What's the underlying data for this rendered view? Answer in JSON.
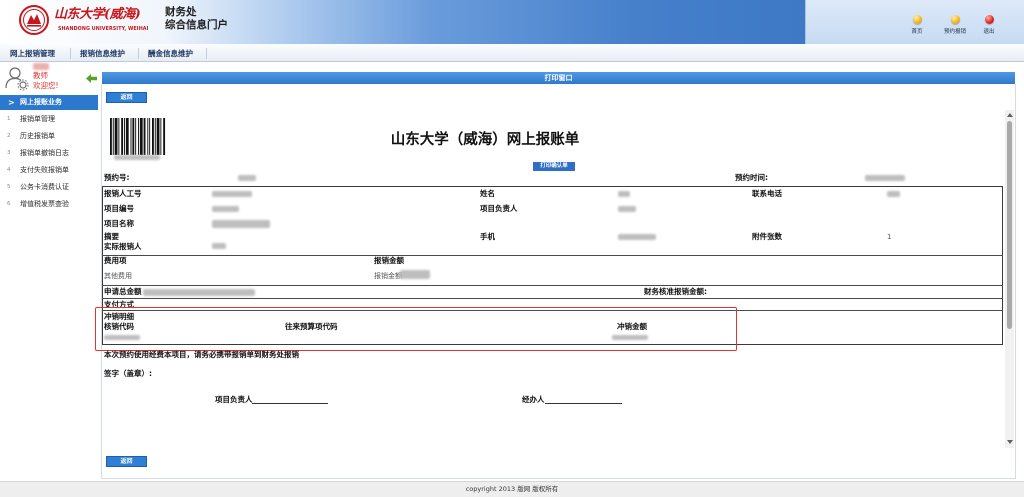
{
  "theme": {
    "accent": "#2f7fd6",
    "title_bar": "#2f79cc",
    "active_nav": "#2c78cf",
    "highlight": "#e3342f",
    "logo_red": "#c8161d",
    "welcome_red": "#e0312f",
    "arrow_green": "#58a12f"
  },
  "header": {
    "logo_text": "山东大学(威海)",
    "logo_subtext": "SHANDONG UNIVERSITY, WEIHAI",
    "dept": "财务处",
    "portal": "综合信息门户",
    "actions": [
      {
        "label": "首页",
        "icon": "home-icon"
      },
      {
        "label": "预约报销",
        "icon": "reservation-icon"
      },
      {
        "label": "退出",
        "icon": "logout-icon"
      }
    ]
  },
  "nav": {
    "tabs": [
      "网上报销管理",
      "报销信息维护",
      "酬金信息维护"
    ]
  },
  "sidebar": {
    "role": "教师",
    "welcome": "欢迎您!",
    "collapse_icon": "arrow-left-icon",
    "active_item": {
      "marker": ">",
      "label": "网上报账业务"
    },
    "items": [
      {
        "num": "1",
        "label": "报销单管理"
      },
      {
        "num": "2",
        "label": "历史报销单"
      },
      {
        "num": "3",
        "label": "报销单撤销日志"
      },
      {
        "num": "4",
        "label": "支付失败报销单"
      },
      {
        "num": "5",
        "label": "公务卡消费认证"
      },
      {
        "num": "6",
        "label": "增值税发票查验"
      }
    ]
  },
  "window": {
    "title": "打印窗口",
    "back_label": "返回"
  },
  "form": {
    "title": "山东大学（威海）网上报账单",
    "print_confirm_label": "打印确认单",
    "reservation_no_label": "预约号:",
    "reservation_time_label": "预约时间:",
    "fields": {
      "staff_id": "报销人工号",
      "name": "姓名",
      "phone": "联系电话",
      "project_no": "项目编号",
      "project_leader": "项目负责人",
      "project_name": "项目名称",
      "summary": "摘要",
      "mobile": "手机",
      "attachments": "附件张数",
      "attachments_value": "1",
      "actual_claimant": "实际报销人"
    },
    "expense": {
      "item_header": "费用项",
      "amount_header": "报销金额",
      "rows": [
        {
          "item": "其他费用",
          "amount_label": "报销金额"
        }
      ]
    },
    "total_label": "申请总金额",
    "approved_label": "财务核准报销金额:",
    "payment_method_label": "支付方式",
    "offset": {
      "title": "冲销明细",
      "columns": [
        "核销代码",
        "往来预算项代码",
        "冲销金额"
      ]
    },
    "note": "本次预约使用经费本项目，请务必携带报销单到财务处报销",
    "signature_label": "签字（盖章）:",
    "signers": [
      "项目负责人",
      "经办人"
    ]
  },
  "footer": {
    "copyright": "copyright 2013 版网 版权所有"
  }
}
